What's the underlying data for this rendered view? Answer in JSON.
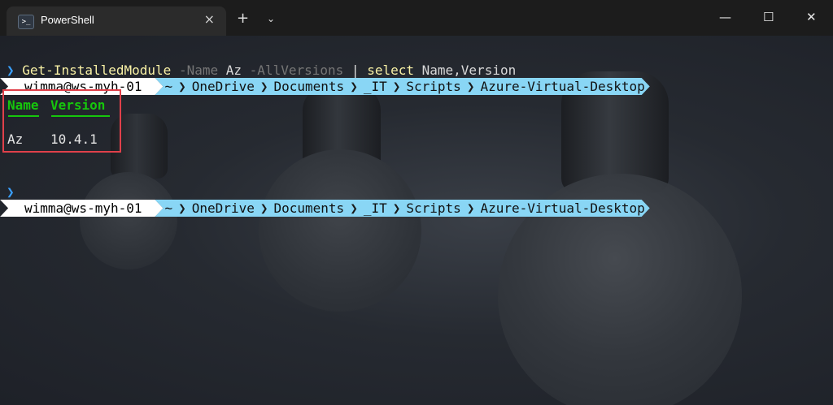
{
  "titlebar": {
    "tab_icon": ">_",
    "tab_title": "PowerShell",
    "close_tab": "×",
    "new_tab": "+",
    "tab_menu": "⌄",
    "minimize": "—",
    "maximize": "☐",
    "close_window": "✕"
  },
  "prompt1": {
    "user": "wimma@ws-myh-01",
    "path": [
      "~",
      "OneDrive",
      "Documents",
      "_IT",
      "Scripts",
      "Azure-Virtual-Desktop"
    ]
  },
  "command": {
    "chevron": "❯",
    "cmdlet": "Get-InstalledModule",
    "param1": "-Name",
    "arg1": "Az",
    "param2": "-AllVersions",
    "pipe": "|",
    "select": "select",
    "fields": "Name,Version"
  },
  "output": {
    "headers": [
      "Name",
      "Version"
    ],
    "rows": [
      [
        "Az",
        "10.4.1"
      ]
    ]
  },
  "prompt2": {
    "user": "wimma@ws-myh-01",
    "path": [
      "~",
      "OneDrive",
      "Documents",
      "_IT",
      "Scripts",
      "Azure-Virtual-Desktop"
    ],
    "chevron": "❯"
  },
  "colors": {
    "prompt_user_bg": "#ffffff",
    "prompt_path_bg": "#89d6f5",
    "cmdlet": "#f9f1a5",
    "parameter": "#767676",
    "header_green": "#16c60c",
    "highlight_border": "#e0404a",
    "chevron_blue": "#3aa0ff"
  }
}
